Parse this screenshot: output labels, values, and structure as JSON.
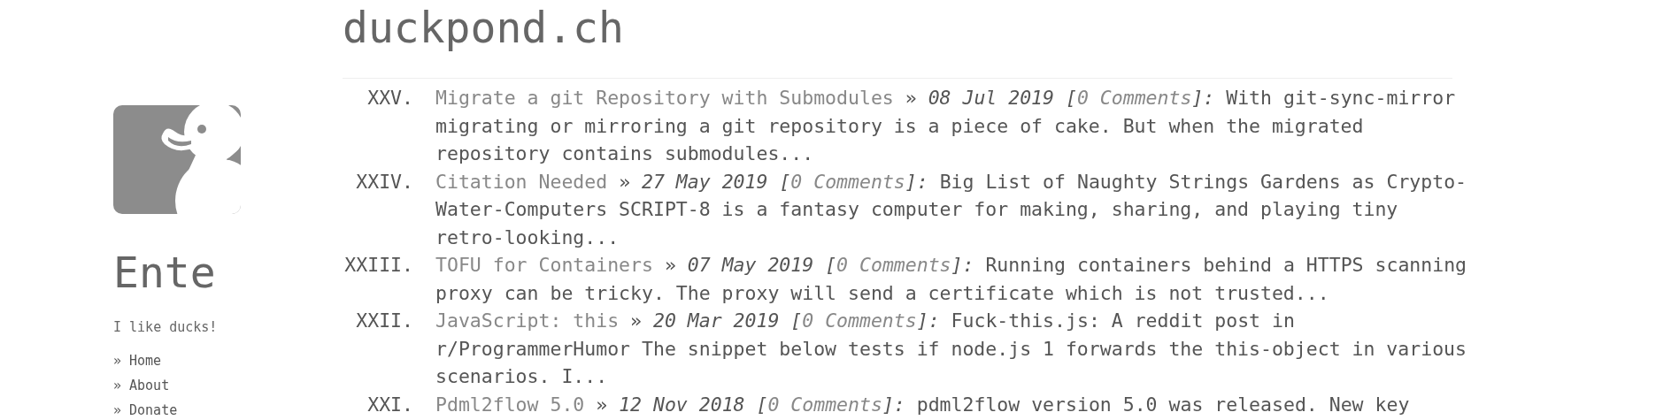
{
  "site_title": "duckpond.ch",
  "sidebar": {
    "name": "Ente",
    "tagline": "I like ducks!",
    "nav": [
      {
        "bullet": "»",
        "label": "Home"
      },
      {
        "bullet": "»",
        "label": "About"
      },
      {
        "bullet": "»",
        "label": "Donate"
      }
    ]
  },
  "posts": [
    {
      "ordinal": "XXV.",
      "title": "Migrate a git Repository with Submodules",
      "arrow": "»",
      "date": "08 Jul 2019",
      "bracket_open": "[",
      "comments": "0 Comments",
      "bracket_close": "]:",
      "excerpt": "With git-sync-mirror migrating or mirroring a git repository is a piece of cake. But when the migrated repository contains submodules..."
    },
    {
      "ordinal": "XXIV.",
      "title": "Citation Needed",
      "arrow": "»",
      "date": "27 May 2019",
      "bracket_open": "[",
      "comments": "0 Comments",
      "bracket_close": "]:",
      "excerpt": "Big List of Naughty Strings Gardens as Crypto-Water-Computers SCRIPT-8 is a fantasy computer for making, sharing, and playing tiny retro-looking..."
    },
    {
      "ordinal": "XXIII.",
      "title": "TOFU for Containers",
      "arrow": "»",
      "date": "07 May 2019",
      "bracket_open": "[",
      "comments": "0 Comments",
      "bracket_close": "]:",
      "excerpt": "Running containers behind a HTTPS scanning proxy can be tricky. The proxy will send a certificate which is not trusted..."
    },
    {
      "ordinal": "XXII.",
      "title": "JavaScript: this",
      "arrow": "»",
      "date": "20 Mar 2019",
      "bracket_open": "[",
      "comments": "0 Comments",
      "bracket_close": "]:",
      "excerpt": "Fuck-this.js: A reddit post in r/ProgrammerHumor The snippet below tests if node.js 1 forwards the this-object in various scenarios. I..."
    },
    {
      "ordinal": "XXI.",
      "title": "Pdml2flow 5.0",
      "arrow": "»",
      "date": "12 Nov 2018",
      "bracket_open": "[",
      "comments": "0 Comments",
      "bracket_close": "]:",
      "excerpt": "pdml2flow version 5.0 was released. New key"
    }
  ]
}
